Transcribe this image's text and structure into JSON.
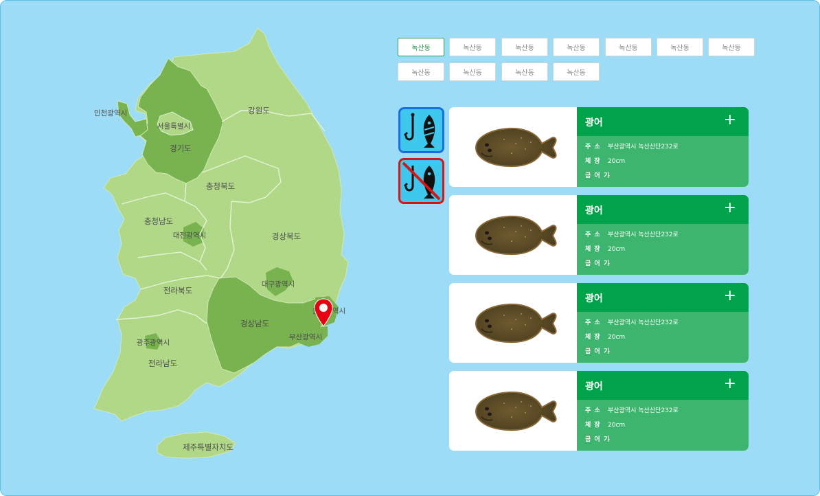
{
  "map": {
    "regions": [
      {
        "key": "incheon",
        "label": "인천광역시"
      },
      {
        "key": "seoul",
        "label": "서울특별시"
      },
      {
        "key": "gyeonggi",
        "label": "경기도"
      },
      {
        "key": "gangwon",
        "label": "강원도"
      },
      {
        "key": "chungbuk",
        "label": "충청북도"
      },
      {
        "key": "chungnam",
        "label": "충청남도"
      },
      {
        "key": "daejeon",
        "label": "대전광역시"
      },
      {
        "key": "gyeongbuk",
        "label": "경상북도"
      },
      {
        "key": "daegu",
        "label": "대구광역시"
      },
      {
        "key": "jeonbuk",
        "label": "전라북도"
      },
      {
        "key": "ulsan",
        "label": "울산광역시"
      },
      {
        "key": "gyeongnam",
        "label": "경상남도"
      },
      {
        "key": "busan",
        "label": "부산광역시"
      },
      {
        "key": "gwangju",
        "label": "광주광역시"
      },
      {
        "key": "jeonnam",
        "label": "전라남도"
      },
      {
        "key": "jeju",
        "label": "제주특별자치도"
      }
    ],
    "colors": {
      "sea": "#9ddcf7",
      "land": "#b1d887",
      "selected": "#78b350",
      "marker": "#e60012"
    }
  },
  "chips": [
    {
      "label": "녹산동",
      "active": true
    },
    {
      "label": "녹산동"
    },
    {
      "label": "녹산동"
    },
    {
      "label": "녹산동"
    },
    {
      "label": "녹산동"
    },
    {
      "label": "녹산동"
    },
    {
      "label": "녹산동"
    },
    {
      "label": "녹산동"
    },
    {
      "label": "녹산동"
    },
    {
      "label": "녹산동"
    },
    {
      "label": "녹산동"
    }
  ],
  "toggles": [
    {
      "icon": "fishing-allowed-icon",
      "color": "#1a6fe0"
    },
    {
      "icon": "fishing-banned-icon",
      "color": "#d91414"
    }
  ],
  "cards": [
    {
      "name": "광어",
      "address_key": "주 소",
      "address": "부산광역시 녹산산단232로",
      "size_key": "체 장",
      "size": "20cm",
      "period_key": "금 어 기",
      "period": "-"
    },
    {
      "name": "광어",
      "address_key": "주 소",
      "address": "부산광역시 녹산산단232로",
      "size_key": "체 장",
      "size": "20cm",
      "period_key": "금 어 기",
      "period": "-"
    },
    {
      "name": "광어",
      "address_key": "주 소",
      "address": "부산광역시 녹산산단232로",
      "size_key": "체 장",
      "size": "20cm",
      "period_key": "금 어 기",
      "period": "-"
    },
    {
      "name": "광어",
      "address_key": "주 소",
      "address": "부산광역시 녹산산단232로",
      "size_key": "체 장",
      "size": "20cm",
      "period_key": "금 어 기",
      "period": "-"
    }
  ],
  "card_plus": "+"
}
